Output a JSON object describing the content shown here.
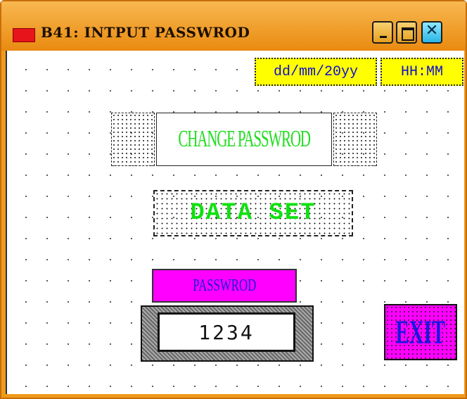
{
  "window": {
    "title": "B41: INTPUT PASSWROD",
    "icon": "red-window-icon",
    "controls": {
      "minimize": "minimize-icon",
      "maximize": "maximize-icon",
      "close_glyph": "✕"
    }
  },
  "header": {
    "date_format": "dd/mm/20yy",
    "time_format": "HH:MM"
  },
  "buttons": {
    "change_password": "CHANGE PASSWROD",
    "data_set": "DATA SET",
    "exit": "EXIT"
  },
  "password": {
    "label": "PASSWROD",
    "value": "1234"
  },
  "colors": {
    "title_bar": "#f09a1c",
    "yellow_box": "#ffff00",
    "magenta": "#ff00ff",
    "green_text": "#22dd22",
    "blue_text": "#1a1ad8"
  }
}
